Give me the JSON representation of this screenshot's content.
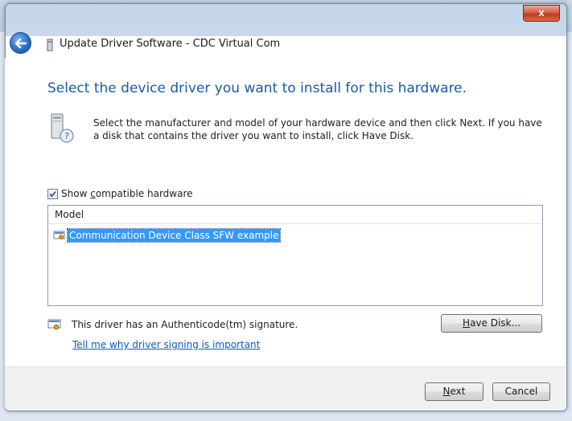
{
  "window": {
    "title": "Update Driver Software - CDC Virtual Com",
    "close_label": "x"
  },
  "main": {
    "heading": "Select the device driver you want to install for this hardware.",
    "description": "Select the manufacturer and model of your hardware device and then click Next. If you have a disk that contains the driver you want to install, click Have Disk.",
    "show_compatible": {
      "pre": "Show ",
      "accel": "c",
      "post": "ompatible hardware",
      "checked": true
    },
    "model_header": "Model",
    "models": [
      "Communication Device Class SFW example"
    ],
    "signature_text": "This driver has an Authenticode(tm) signature.",
    "signing_link": "Tell me why driver signing is important"
  },
  "buttons": {
    "have_disk": {
      "accel": "H",
      "rest": "ave Disk..."
    },
    "next": {
      "accel": "N",
      "rest": "ext"
    },
    "cancel": "Cancel"
  },
  "colors": {
    "heading": "#1a5aa6",
    "selection": "#3399ff",
    "link": "#0b59b8",
    "close": "#c13a1f"
  }
}
